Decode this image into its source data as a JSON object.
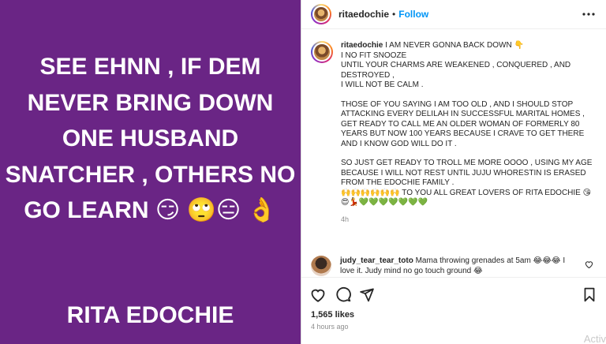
{
  "image_post": {
    "caption_text": "SEE EHNN , IF DEM NEVER BRING DOWN ONE HUSBAND SNATCHER , OTHERS NO GO LEARN 😏 🙄😑 👌",
    "signature": "RITA EDOCHIE",
    "background_color": "#6a2585"
  },
  "header": {
    "username": "ritaedochie",
    "separator": "•",
    "follow_label": "Follow",
    "more_icon": "more-horizontal-icon"
  },
  "caption": {
    "username": "ritaedochie",
    "line1": " I AM NEVER GONNA BACK DOWN 👇\nI NO FIT SNOOZE\nUNTIL YOUR CHARMS ARE WEAKENED , CONQUERED , AND DESTROYED ,\nI WILL NOT BE CALM .",
    "para2": "THOSE OF YOU SAYING I AM TOO OLD , AND I SHOULD STOP ATTACKING EVERY DELILAH IN SUCCESSFUL MARITAL HOMES , GET READY TO CALL ME AN OLDER WOMAN OF FORMERLY 80 YEARS BUT NOW 100 YEARS BECAUSE I CRAVE TO GET THERE AND I KNOW GOD WILL DO IT .",
    "para3": "SO JUST GET READY TO TROLL ME MORE OOOO , USING MY AGE BECAUSE I WILL NOT REST UNTIL JUJU WHORESTIN IS ERASED FROM THE EDOCHIE FAMILY .\n🙌🙌🙌🙌🙌🙌 TO YOU ALL GREAT LOVERS OF RITA EDOCHIE 😘😍💃💚💚💚💚💚💚💚",
    "time": "4h"
  },
  "comment": {
    "username": "judy_tear_tear_toto",
    "text": " Mama throwing grenades at 5am 😂😂😂 I love it. Judy mind no go touch ground 😂",
    "like_icon": "heart-outline-icon"
  },
  "actions": {
    "like_icon": "heart-outline-icon",
    "comment_icon": "comment-bubble-icon",
    "share_icon": "paper-plane-icon",
    "save_icon": "bookmark-icon"
  },
  "likes_text": "1,565 likes",
  "time_ago": "4 hours ago",
  "watermark": "Activ"
}
